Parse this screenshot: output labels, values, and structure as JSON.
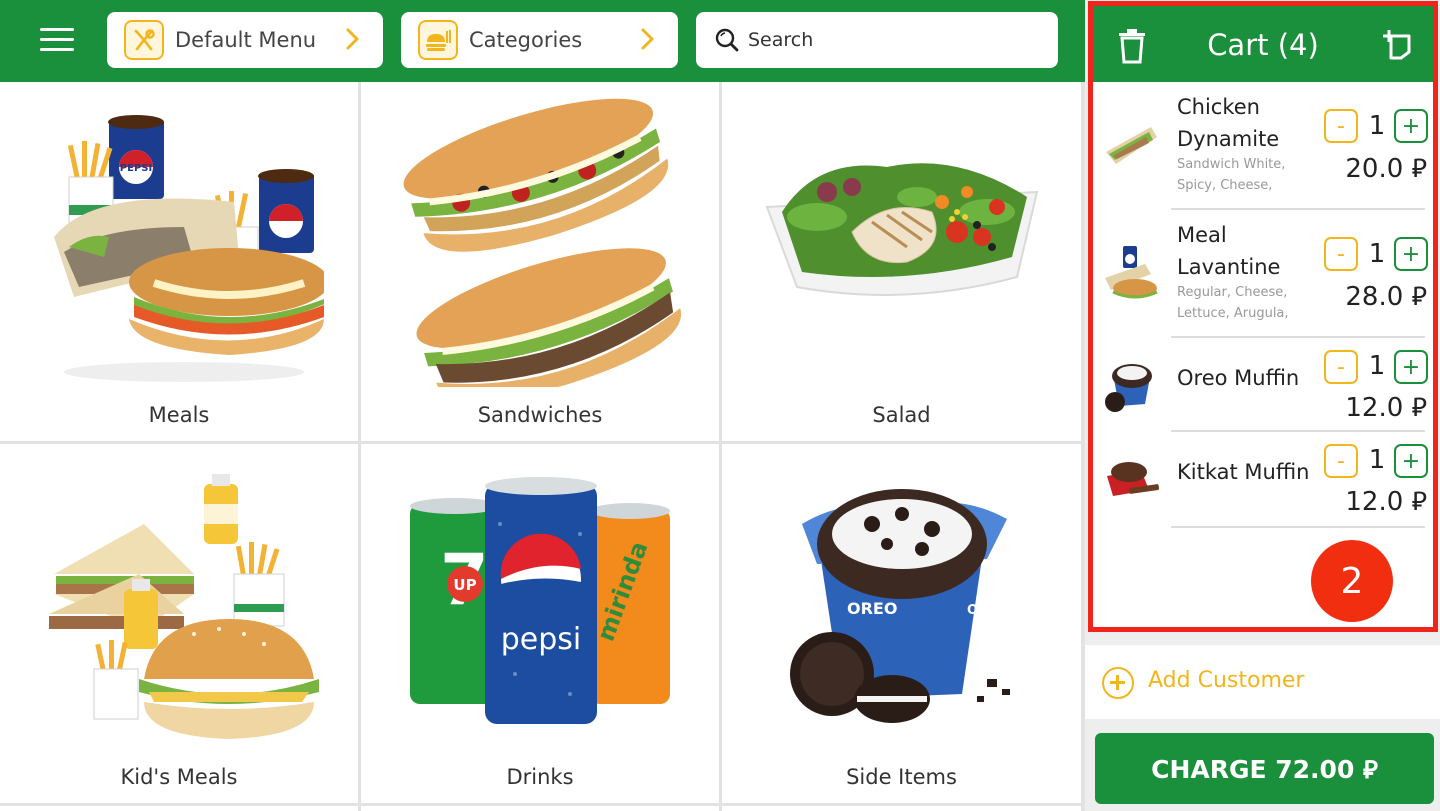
{
  "topbar": {
    "menu_pill": {
      "label": "Default Menu",
      "icon": "fork-spoon-icon"
    },
    "categories_pill": {
      "label": "Categories",
      "icon": "burger-fries-icon"
    },
    "search": {
      "placeholder": "Search"
    }
  },
  "categories": [
    {
      "label": "Meals",
      "image": "meal-combo-image"
    },
    {
      "label": "Sandwiches",
      "image": "sandwiches-image"
    },
    {
      "label": "Salad",
      "image": "salad-image"
    },
    {
      "label": "Kid's Meals",
      "image": "kids-meal-image"
    },
    {
      "label": "Drinks",
      "image": "drink-cans-image"
    },
    {
      "label": "Side Items",
      "image": "muffin-image"
    }
  ],
  "cart": {
    "title": "Cart (4)",
    "currency": "⃁",
    "items": [
      {
        "name_line1": "Chicken",
        "name_line2": "Dynamite",
        "mods": "Sandwich White, Spicy, Cheese,",
        "qty": "1",
        "price": "20.0 ⃁"
      },
      {
        "name_line1": "Meal",
        "name_line2": "Lavantine",
        "mods": "Regular, Cheese, Lettuce, Arugula,",
        "qty": "1",
        "price": "28.0 ⃁"
      },
      {
        "name_line1": "Oreo Muffin",
        "name_line2": "",
        "mods": "",
        "qty": "1",
        "price": "12.0 ⃁"
      },
      {
        "name_line1": "Kitkat Muffin",
        "name_line2": "",
        "mods": "",
        "qty": "1",
        "price": "12.0 ⃁"
      }
    ],
    "minus_label": "-",
    "plus_label": "+",
    "annotation_badge": "2"
  },
  "add_customer": {
    "label": "Add Customer"
  },
  "charge": {
    "label": "CHARGE 72.00 ⃁"
  },
  "colors": {
    "brand_green": "#1a8f3c",
    "accent_yellow": "#f2b51d",
    "highlight_red": "#f0241b"
  }
}
